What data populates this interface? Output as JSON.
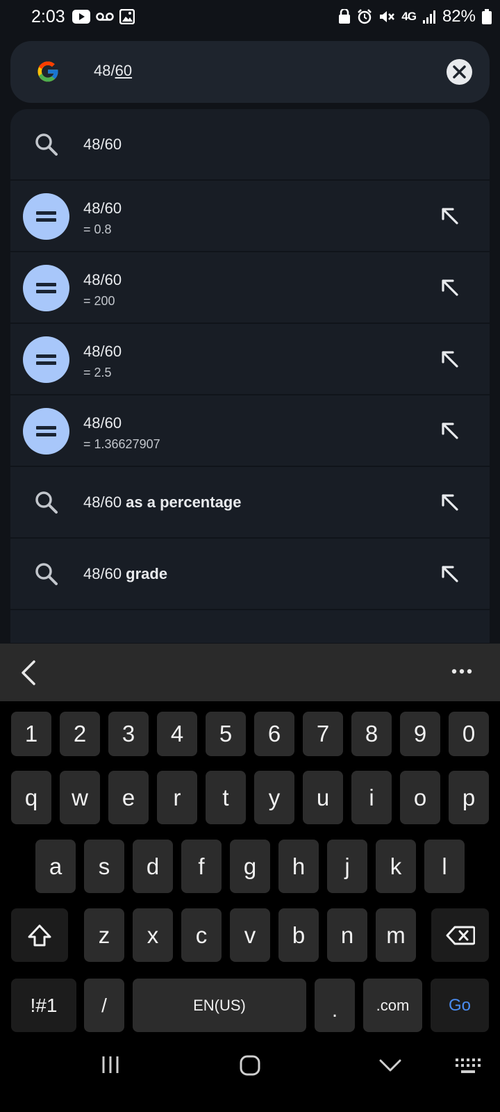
{
  "status_bar": {
    "time": "2:03",
    "network": "4G",
    "battery": "82%"
  },
  "search": {
    "query_prefix": "48/",
    "query_underlined": "60"
  },
  "suggestions": [
    {
      "type": "search",
      "title": "48/60"
    },
    {
      "type": "calc",
      "title": "48/60",
      "result": "= 0.8"
    },
    {
      "type": "calc",
      "title": "48/60",
      "result": "= 200"
    },
    {
      "type": "calc",
      "title": "48/60",
      "result": "= 2.5"
    },
    {
      "type": "calc",
      "title": "48/60",
      "result": "= 1.36627907"
    },
    {
      "type": "search",
      "title_plain": "48/60 ",
      "title_bold": "as a percentage"
    },
    {
      "type": "search",
      "title_plain": "48/60 ",
      "title_bold": "grade"
    }
  ],
  "keyboard": {
    "number_row": [
      "1",
      "2",
      "3",
      "4",
      "5",
      "6",
      "7",
      "8",
      "9",
      "0"
    ],
    "row1": [
      "q",
      "w",
      "e",
      "r",
      "t",
      "y",
      "u",
      "i",
      "o",
      "p"
    ],
    "row2": [
      "a",
      "s",
      "d",
      "f",
      "g",
      "h",
      "j",
      "k",
      "l"
    ],
    "row3": [
      "z",
      "x",
      "c",
      "v",
      "b",
      "n",
      "m"
    ],
    "symbols_label": "!#1",
    "slash_label": "/",
    "space_label": "EN(US)",
    "period_label": ".",
    "dotcom_label": ".com",
    "go_label": "Go"
  },
  "colors": {
    "background": "#101318",
    "panel": "#181d25",
    "calc_icon_bg": "#a8c7fa",
    "go_accent": "#4a8cf0"
  }
}
